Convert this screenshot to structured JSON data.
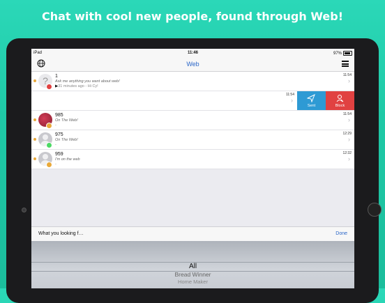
{
  "headline": "Chat with cool new people, found through Web!",
  "statusbar": {
    "device": "iPad",
    "time": "11:46",
    "battery": "97%"
  },
  "nav": {
    "title": "Web"
  },
  "chats": [
    {
      "name": "1",
      "preview": "Ask me anything you want about web!",
      "meta": "31 minutes ago - Hi Cy!",
      "time": "11:54",
      "badge_color": "#e14141",
      "avatar": "question"
    },
    {
      "name": "",
      "preview": "",
      "meta": "",
      "time": "11:54",
      "swiped": true
    },
    {
      "name": "985",
      "preview": "On The Web!",
      "meta": "-",
      "time": "11:54",
      "badge_color": "#e9a93a",
      "avatar": "photo"
    },
    {
      "name": "975",
      "preview": "On The Web!",
      "meta": "-",
      "time": "12:29",
      "badge_color": "#4cd964",
      "avatar": "silhouette"
    },
    {
      "name": "959",
      "preview": "I'm on the web",
      "meta": "-",
      "time": "12:32",
      "badge_color": "#e9a93a",
      "avatar": "silhouette"
    }
  ],
  "swipe_actions": {
    "sent": "Sent",
    "block": "Block"
  },
  "picker": {
    "question": "What you looking f…",
    "done": "Done",
    "options": [
      "All",
      "Bread Winner",
      "Home Maker"
    ]
  },
  "colors": {
    "accent": "#2a66c8",
    "sent": "#2e9ad4",
    "block": "#e14141",
    "background": "#1fc9a6"
  },
  "icons": [
    "globe-icon",
    "menu-icon",
    "chevron-right-icon",
    "send-icon",
    "block-icon",
    "play-icon"
  ]
}
